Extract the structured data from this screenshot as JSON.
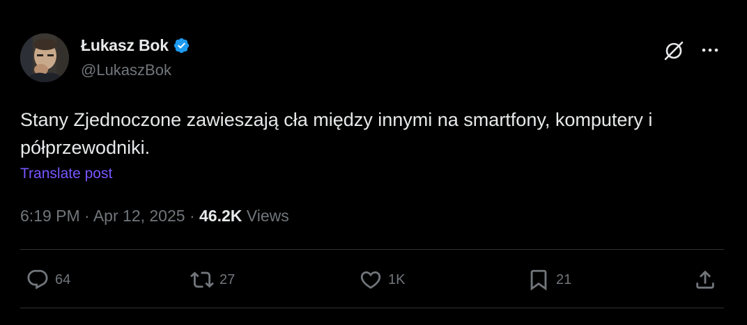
{
  "author": {
    "name": "Łukasz Bok",
    "handle": "@LukaszBok",
    "verified": true,
    "verified_color": "#1d9bf0"
  },
  "post": {
    "text": "Stany Zjednoczone zawieszają cła między innymi na smartfony, komputery i półprzewodniki.",
    "translate_label": "Translate post",
    "time": "6:19 PM",
    "separator": "·",
    "date": "Apr 12, 2025",
    "views_count": "46.2K",
    "views_label": "Views"
  },
  "header_icons": {
    "grok": "grok-icon",
    "more": "more-icon"
  },
  "actions": {
    "replies": "64",
    "reposts": "27",
    "likes": "1K",
    "bookmarks": "21",
    "share": "share-icon"
  },
  "colors": {
    "background": "#000000",
    "text": "#e7e9ea",
    "muted": "#71767b",
    "link": "#7856ff",
    "divider": "#2f3336"
  }
}
